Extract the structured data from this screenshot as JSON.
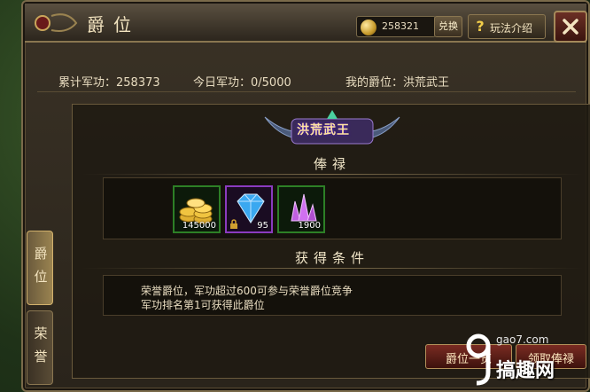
{
  "window": {
    "title": "爵位"
  },
  "header": {
    "currency_value": "258321",
    "exchange_label": "兑换",
    "help_label": "玩法介绍",
    "help_icon": "?"
  },
  "info": {
    "total": "累计军功：258373",
    "today": "今日军功：0/5000",
    "mine": "我的爵位：洪荒武王"
  },
  "tabs": [
    {
      "label": "爵位",
      "active": true
    },
    {
      "label": "荣誉",
      "active": false
    }
  ],
  "banner": {
    "title": "洪荒武王"
  },
  "rewards": {
    "title": "俸禄",
    "items": [
      {
        "icon": "gold-coins-icon",
        "count": "145000",
        "frame": "green"
      },
      {
        "icon": "blue-diamond-icon",
        "count": "95",
        "frame": "purple"
      },
      {
        "icon": "purple-crystal-icon",
        "count": "1900",
        "frame": "green"
      }
    ]
  },
  "conditions": {
    "title": "获得条件",
    "lines": [
      "荣誉爵位，军功超过600可参与荣誉爵位竞争",
      "军功排名第1可获得此爵位"
    ]
  },
  "buttons": {
    "list_label": "爵位一览",
    "claim_label": "领取俸禄"
  },
  "watermark": {
    "site": "gao7.com",
    "name": "搞趣网"
  },
  "colors": {
    "frame_gold": "#8a7650",
    "button_red": "#7a2b22",
    "green_frame": "#2d7f26",
    "purple_frame": "#8a3bbf"
  }
}
